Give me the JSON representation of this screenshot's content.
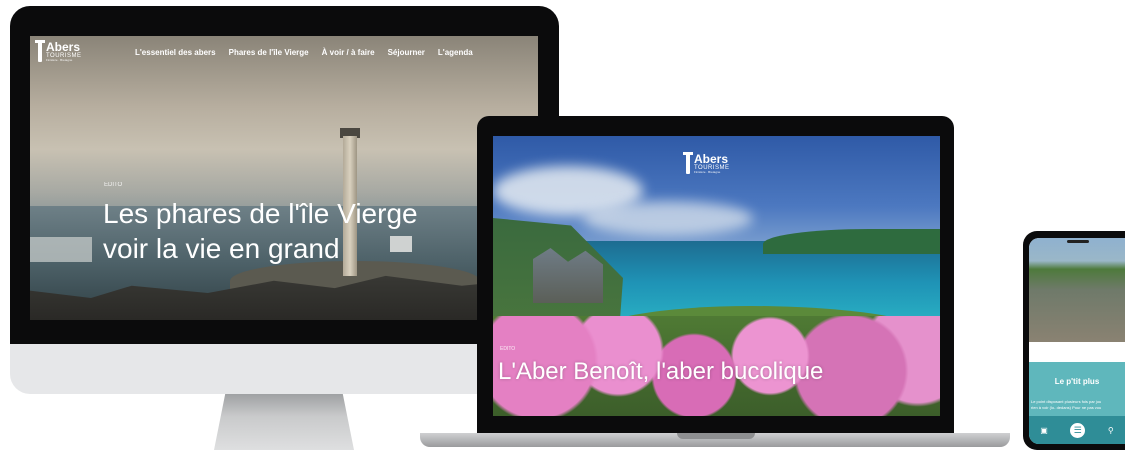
{
  "desktop": {
    "logo": {
      "name": "Abers",
      "sub": "TOURISME",
      "tag": "Finistère · Bretagne"
    },
    "nav": [
      "L'essentiel des abers",
      "Phares de l'île Vierge",
      "À voir / à faire",
      "Séjourner",
      "L'agenda"
    ],
    "edito": "EDITO",
    "headline_line1": "Les phares de l'île Vierge",
    "headline_line2": "voir la vie en grand"
  },
  "laptop": {
    "logo": {
      "name": "Abers",
      "sub": "TOURISME",
      "tag": "Finistère · Bretagne"
    },
    "edito": "EDITO",
    "headline": "L'Aber Benoît, l'aber bucolique"
  },
  "phone": {
    "title": "Le p'tit plus",
    "text_line1": "Le point disposant plusieurs fois par jou",
    "text_line2": "rien à voir (lo- dedans) Pour ne pas vou",
    "icons": [
      "basket-icon",
      "menu-icon",
      "search-icon"
    ]
  },
  "colors": {
    "teal_band": "#5fb7bc",
    "teal_bar": "#2f8d97",
    "bezel": "#0b0b0c",
    "device_silver": "#e6e7e9"
  }
}
